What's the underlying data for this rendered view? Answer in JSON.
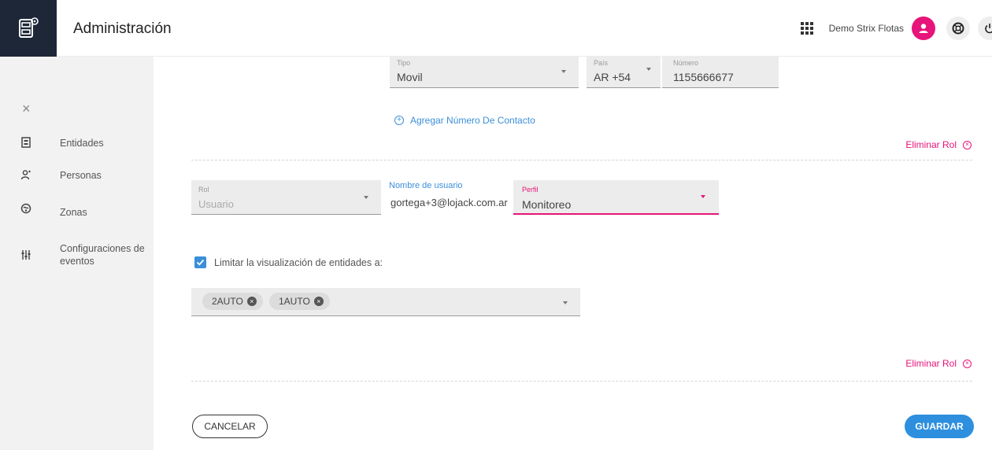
{
  "header": {
    "app_title": "Administración",
    "user_name": "Demo Strix Flotas",
    "logo_icon": "fleet-admin-logo",
    "apps_icon": "grid-apps-icon",
    "avatar_icon": "user-avatar-icon",
    "help_icon": "lifebuoy-help-icon",
    "power_icon": "power-icon",
    "accent_color": "#e7147a",
    "logo_bg": "#1d2738"
  },
  "sidebar": {
    "close_icon": "close-icon",
    "items": [
      {
        "label": "Entidades",
        "icon": "building-icon"
      },
      {
        "label": "Personas",
        "icon": "people-icon"
      },
      {
        "label": "Zonas",
        "icon": "map-zones-icon"
      },
      {
        "label": "Configuraciones de eventos",
        "icon": "sliders-icon"
      }
    ]
  },
  "contact": {
    "tipo_label": "Tipo",
    "tipo_value": "Movil",
    "pais_label": "País",
    "pais_value": "AR +54",
    "numero_label": "Número",
    "numero_value": "1155666677",
    "add_contact_label": "Agregar Número De Contacto"
  },
  "roles": {
    "eliminar_label": "Eliminar Rol",
    "rol_label": "Rol",
    "rol_value": "Usuario",
    "username_label": "Nombre de usuario",
    "username_value": "gortega+3@lojack.com.ar",
    "perfil_label": "Perfil",
    "perfil_value": "Monitoreo",
    "limit_label": "Limitar la visualización de entidades a:",
    "limit_checked": true,
    "chips": [
      "2AUTO",
      "1AUTO"
    ]
  },
  "actions": {
    "cancel_label": "CANCELAR",
    "save_label": "GUARDAR",
    "save_color": "#2d8fde"
  }
}
